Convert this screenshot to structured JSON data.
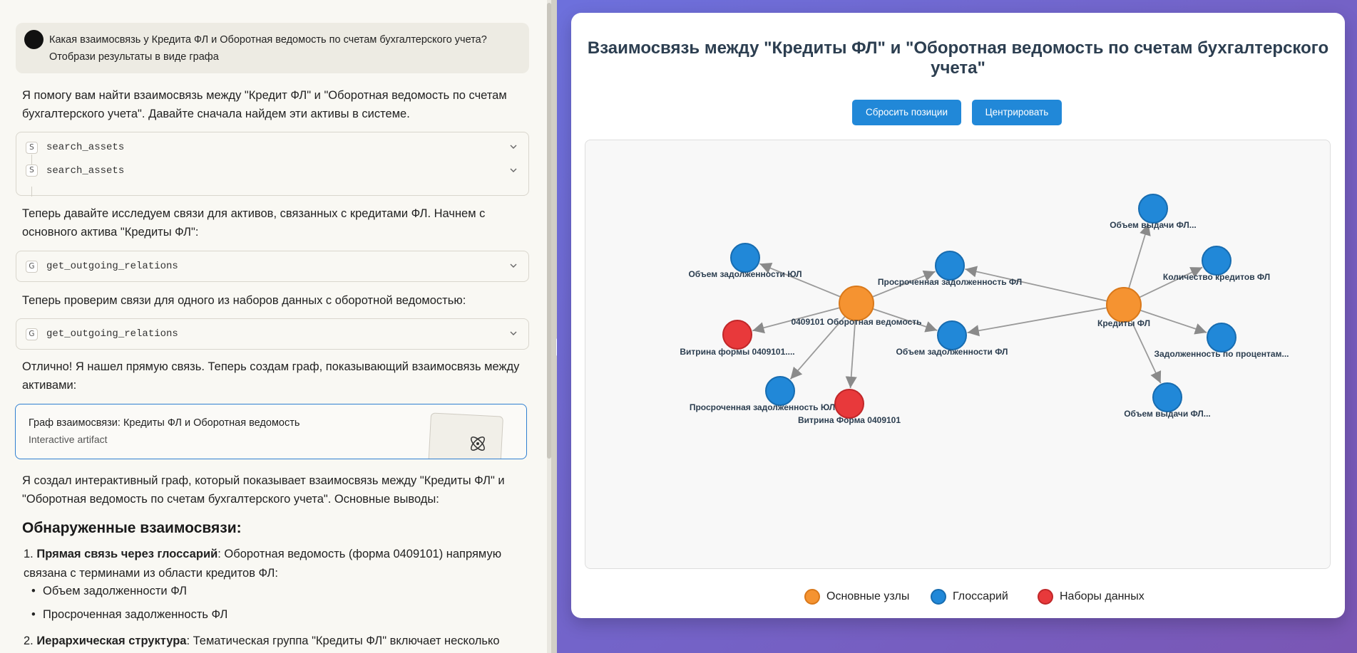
{
  "chat": {
    "user_message": "Какая взаимосвязь у Кредита ФЛ и Оборотная ведомость по счетам бухгалтерского учета? Отобрази результаты в виде графа",
    "para1": "Я помогу вам найти взаимосвязь между \"Кредит ФЛ\" и \"Оборотная ведомость по счетам бухгалтерского учета\". Давайте сначала найдем эти активы в системе.",
    "tools1": [
      {
        "badge": "S",
        "name": "search_assets"
      },
      {
        "badge": "S",
        "name": "search_assets"
      }
    ],
    "para2": "Теперь давайте исследуем связи для активов, связанных с кредитами ФЛ. Начнем с основного актива \"Кредиты ФЛ\":",
    "tool2": {
      "badge": "G",
      "name": "get_outgoing_relations"
    },
    "para3": "Теперь проверим связи для одного из наборов данных с оборотной ведомостью:",
    "tool3": {
      "badge": "G",
      "name": "get_outgoing_relations"
    },
    "para4": "Отлично! Я нашел прямую связь. Теперь создам граф, показывающий взаимосвязь между активами:",
    "artifact": {
      "title": "Граф взаимосвязи: Кредиты ФЛ и Оборотная ведомость",
      "subtitle": "Interactive artifact"
    },
    "para5": "Я создал интерактивный граф, который показывает взаимосвязь между \"Кредиты ФЛ\" и \"Оборотная ведомость по счетам бухгалтерского учета\". Основные выводы:",
    "heading": "Обнаруженные взаимосвязи:",
    "ol": [
      {
        "num": "1.",
        "bold": "Прямая связь через глоссарий",
        "text": ": Оборотная ведомость (форма 0409101) напрямую связана с терминами из области кредитов ФЛ:"
      },
      {
        "num": "2.",
        "bold": "Иерархическая структура",
        "text": ": Тематическая группа \"Кредиты ФЛ\" включает несколько"
      }
    ],
    "ul": [
      "Объем задолженности ФЛ",
      "Просроченная задолженность ФЛ"
    ]
  },
  "viewer": {
    "title": "Взаимосвязь между \"Кредиты ФЛ\" и \"Оборотная ведомость по счетам бухгалтерского учета\"",
    "reset_label": "Сбросить позиции",
    "center_label": "Центрировать",
    "colors": {
      "main": "#f59331",
      "glossary": "#2188d8",
      "dataset": "#e8393b",
      "edge": "#9a9a9a"
    },
    "legend": [
      {
        "label": "Основные узлы",
        "color": "#f59331",
        "border": "#d9781a"
      },
      {
        "label": "Глоссарий",
        "color": "#2188d8",
        "border": "#176cb0"
      },
      {
        "label": "Наборы данных",
        "color": "#e8393b",
        "border": "#c02729"
      }
    ]
  },
  "graph": {
    "nodes": [
      {
        "id": "obor",
        "label": "0409101 Оборотная ведомость",
        "group": "main"
      },
      {
        "id": "kred",
        "label": "Кредиты ФЛ",
        "group": "main"
      },
      {
        "id": "ozul",
        "label": "Объем задолженности ЮЛ",
        "group": "glossary"
      },
      {
        "id": "vitr1",
        "label": "Витрина формы 0409101....",
        "group": "dataset"
      },
      {
        "id": "przul",
        "label": "Просроченная задолженность ЮЛ",
        "group": "glossary"
      },
      {
        "id": "vitr2",
        "label": "Витрина Форма 0409101",
        "group": "dataset"
      },
      {
        "id": "przfl",
        "label": "Просроченная задолженность ФЛ",
        "group": "glossary"
      },
      {
        "id": "ozfl",
        "label": "Объем задолженности ФЛ",
        "group": "glossary"
      },
      {
        "id": "ovfl1",
        "label": "Объем выдачи ФЛ...",
        "group": "glossary"
      },
      {
        "id": "kolkr",
        "label": "Количество кредитов ФЛ",
        "group": "glossary"
      },
      {
        "id": "zadpr",
        "label": "Задолженность по процентам...",
        "group": "glossary"
      },
      {
        "id": "ovfl2",
        "label": "Объем выдачи ФЛ...",
        "group": "glossary"
      }
    ],
    "edges": [
      {
        "from": "obor",
        "to": "ozul"
      },
      {
        "from": "obor",
        "to": "vitr1"
      },
      {
        "from": "obor",
        "to": "przul"
      },
      {
        "from": "obor",
        "to": "vitr2"
      },
      {
        "from": "obor",
        "to": "przfl"
      },
      {
        "from": "obor",
        "to": "ozfl"
      },
      {
        "from": "kred",
        "to": "przfl"
      },
      {
        "from": "kred",
        "to": "ozfl"
      },
      {
        "from": "kred",
        "to": "ovfl1"
      },
      {
        "from": "kred",
        "to": "kolkr"
      },
      {
        "from": "kred",
        "to": "zadpr"
      },
      {
        "from": "kred",
        "to": "ovfl2"
      }
    ]
  }
}
